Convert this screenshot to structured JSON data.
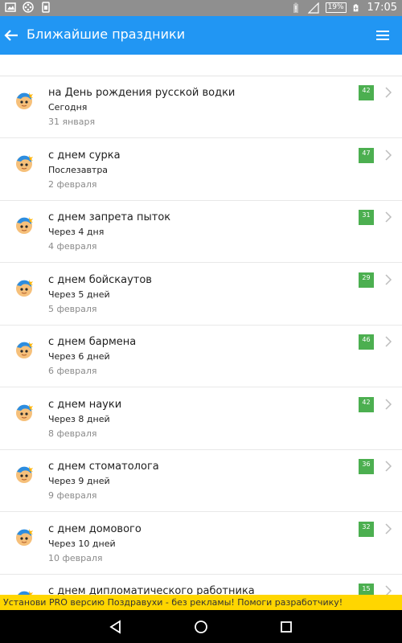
{
  "status_bar": {
    "battery": "19%",
    "time": "17:05",
    "icons": [
      "image-icon",
      "film-icon",
      "sim-icon",
      "battery-alert-icon",
      "signal-icon",
      "battery-icon"
    ]
  },
  "app_bar": {
    "title": "Ближайшие праздники",
    "back_icon": "arrow-back-icon",
    "menu_icon": "menu-icon"
  },
  "colors": {
    "app_bar": "#2196f3",
    "badge": "#4caf50",
    "promo": "#ffd600"
  },
  "holidays": [
    {
      "name": "на День рождения русской водки",
      "relative": "Сегодня",
      "date": "31 января",
      "badge": "42"
    },
    {
      "name": "с днем сурка",
      "relative": "Послезавтра",
      "date": "2 февраля",
      "badge": "47"
    },
    {
      "name": "с днем запрета пыток",
      "relative": "Через 4 дня",
      "date": "4 февраля",
      "badge": "31"
    },
    {
      "name": "с днем бойскаутов",
      "relative": "Через 5 дней",
      "date": "5 февраля",
      "badge": "29"
    },
    {
      "name": "с днем бармена",
      "relative": "Через 6 дней",
      "date": "6 февраля",
      "badge": "46"
    },
    {
      "name": "с днем науки",
      "relative": "Через 8 дней",
      "date": "8 февраля",
      "badge": "42"
    },
    {
      "name": "с днем стоматолога",
      "relative": "Через 9 дней",
      "date": "9 февраля",
      "badge": "36"
    },
    {
      "name": "с днем домового",
      "relative": "Через 10 дней",
      "date": "10 февраля",
      "badge": "32"
    },
    {
      "name": "с днем дипломатического работника",
      "relative": "",
      "date": "",
      "badge": "15"
    }
  ],
  "promo": "Установи PRO версию Поздравухи - без рекламы! Помоги разработчику!",
  "nav_bar": {
    "icons": [
      "back-triangle-icon",
      "home-circle-icon",
      "recents-square-icon"
    ]
  }
}
